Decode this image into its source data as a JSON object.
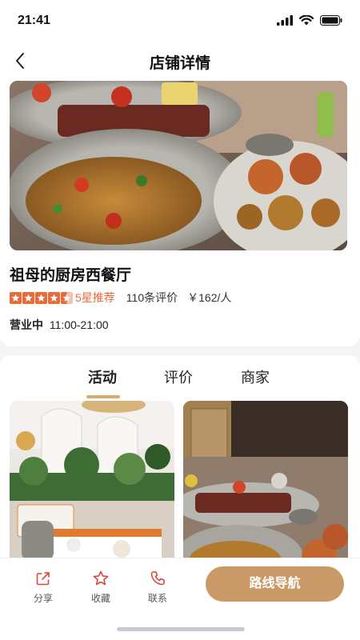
{
  "status": {
    "time": "21:41"
  },
  "nav": {
    "title": "店铺详情"
  },
  "store": {
    "name": "祖母的厨房西餐厅",
    "rating_stars": 4.5,
    "recommend": "5星推荐",
    "reviews": "110条评价",
    "price": "￥162/人",
    "open_status": "营业中",
    "hours": "11:00-21:00"
  },
  "tabs": [
    {
      "label": "活动",
      "active": true
    },
    {
      "label": "评价",
      "active": false
    },
    {
      "label": "商家",
      "active": false
    }
  ],
  "actions": {
    "share": "分享",
    "favorite": "收藏",
    "contact": "联系",
    "route": "路线导航"
  },
  "colors": {
    "accent": "#ea6a3a",
    "brand": "#c99a68",
    "underline": "#d7a870"
  }
}
